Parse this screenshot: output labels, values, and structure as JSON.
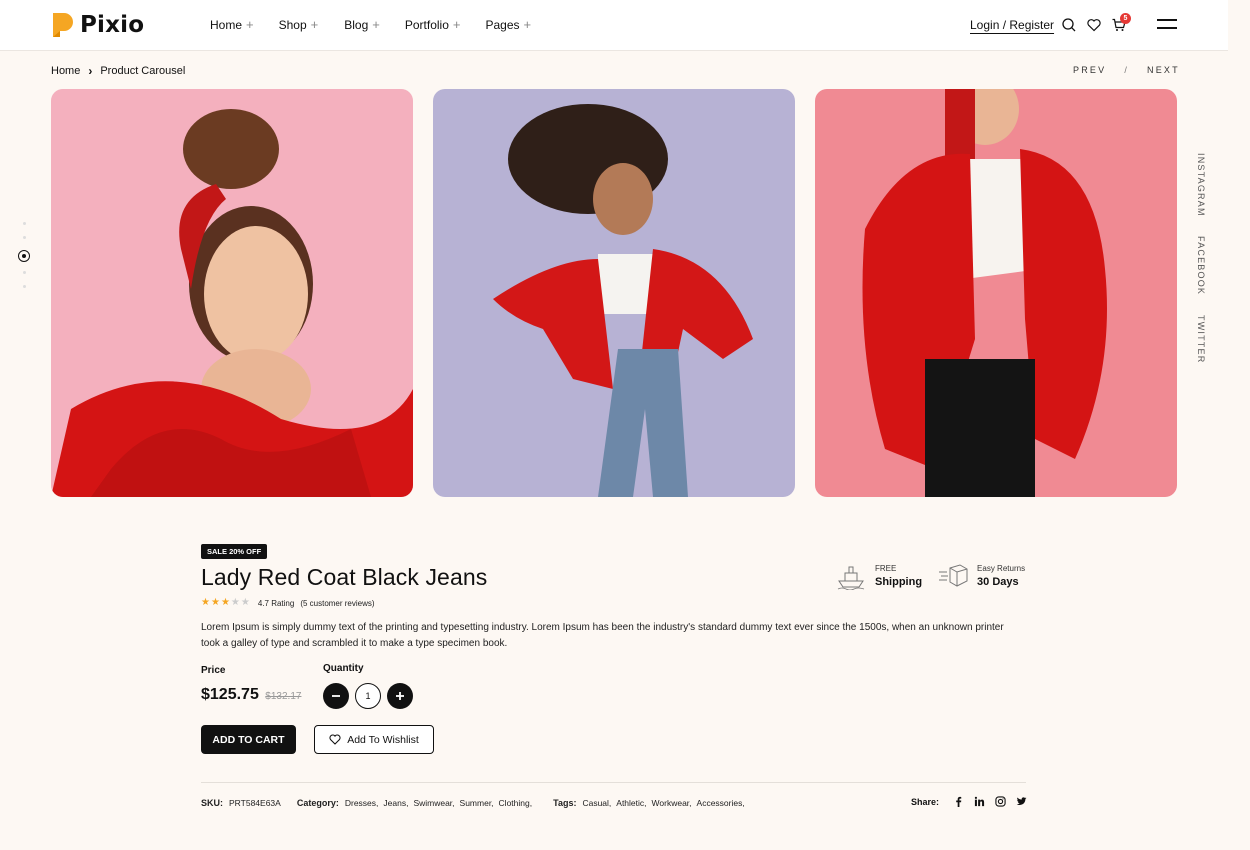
{
  "brand": {
    "name": "Pixio"
  },
  "nav": {
    "items": [
      {
        "label": "Home",
        "plus": "+"
      },
      {
        "label": "Shop",
        "plus": "+"
      },
      {
        "label": "Blog",
        "plus": "+"
      },
      {
        "label": "Portfolio",
        "plus": "+"
      },
      {
        "label": "Pages",
        "plus": "+"
      }
    ],
    "login_label": "Login / Register",
    "cart_count": "5"
  },
  "breadcrumb": {
    "home": "Home",
    "current": "Product Carousel"
  },
  "pager": {
    "prev": "PREV",
    "sep": "/",
    "next": "NEXT"
  },
  "social_vertical": [
    "INSTAGRAM",
    "FACEBOOK",
    "TWITTER"
  ],
  "product": {
    "badge": "SALE 20% OFF",
    "title": "Lady Red Coat Black Jeans",
    "stars": 3,
    "stars_max": 5,
    "rating_text": "4.7 Rating",
    "reviews_text": "(5 customer reviews)",
    "description": "Lorem Ipsum is simply dummy text of the printing and typesetting industry. Lorem Ipsum has been the industry's standard dummy text ever since the 1500s, when an unknown printer took a galley of type and scrambled it to make a type specimen book.",
    "price_label": "Price",
    "price": "$125.75",
    "old_price": "$132.17",
    "quantity_label": "Quantity",
    "quantity": "1",
    "add_to_cart": "ADD TO CART",
    "wishlist": "Add To Wishlist",
    "features": [
      {
        "small": "FREE",
        "big": "Shipping"
      },
      {
        "small": "Easy Returns",
        "big": "30 Days"
      }
    ],
    "sku_label": "SKU:",
    "sku": "PRT584E63A",
    "category_label": "Category:",
    "categories": [
      "Dresses,",
      "Jeans,",
      "Swimwear,",
      "Summer,",
      "Clothing,"
    ],
    "tags_label": "Tags:",
    "tags": [
      "Casual,",
      "Athletic,",
      "Workwear,",
      "Accessories,"
    ],
    "share_label": "Share:"
  },
  "colors": {
    "accent_logo": "#f5a623",
    "badge": "#e53935",
    "star": "#f5a623",
    "dark": "#111111"
  }
}
